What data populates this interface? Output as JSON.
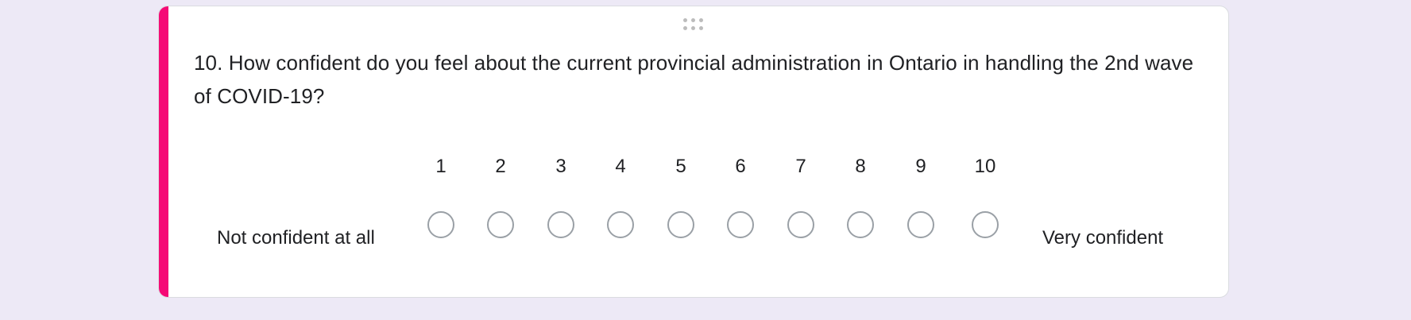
{
  "question": {
    "text": "10. How confident do you feel about the current provincial administration in Ontario in handling the 2nd wave of COVID-19?"
  },
  "scale": {
    "numbers": [
      "1",
      "2",
      "3",
      "4",
      "5",
      "6",
      "7",
      "8",
      "9",
      "10"
    ],
    "low_label": "Not confident at all",
    "high_label": "Very confident",
    "selected": null
  },
  "colors": {
    "accent": "#f50a76",
    "background": "#ede9f6",
    "radio_border": "#9aa0a6"
  }
}
